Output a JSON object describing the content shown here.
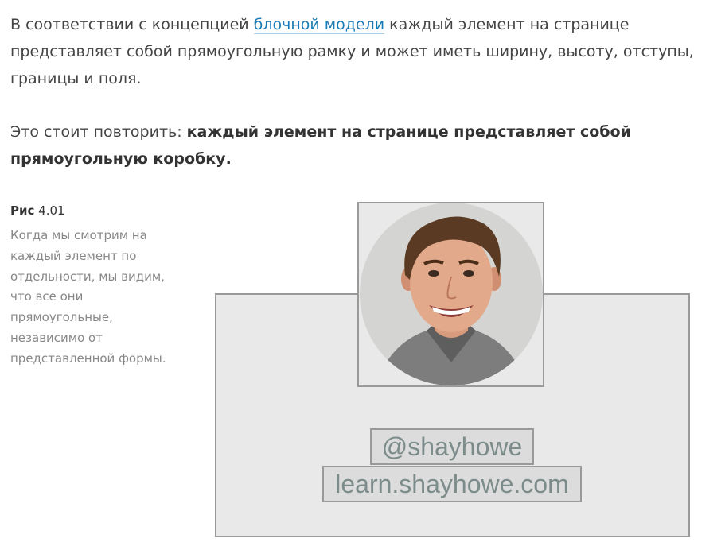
{
  "intro": {
    "before_link": "В соответствии с концепцией ",
    "link": "блочной модели",
    "after_link": " каждый элемент на странице представляет собой прямоугольную рамку и может иметь ширину, высоту, отступы, границы и поля."
  },
  "emphasis": {
    "lead": "Это стоит повторить: ",
    "bold": "каждый элемент на странице представляет собой прямоугольную коробку",
    "end": "."
  },
  "figure": {
    "label_bold": "Рис",
    "label_number": " 4.01",
    "caption": "Когда мы смотрим на каждый элемент по отдельности, мы видим, что все они прямоугольные, независимо от представленной формы.",
    "handle": "@shayhowe",
    "site": "learn.shayhowe.com"
  },
  "colors": {
    "link": "#1b7bb6",
    "box_fill": "#e9e9e9",
    "box_border": "#9a9a9a",
    "tag_text": "#7c8c8a"
  },
  "icons": {
    "portrait": "person-portrait-photo"
  }
}
